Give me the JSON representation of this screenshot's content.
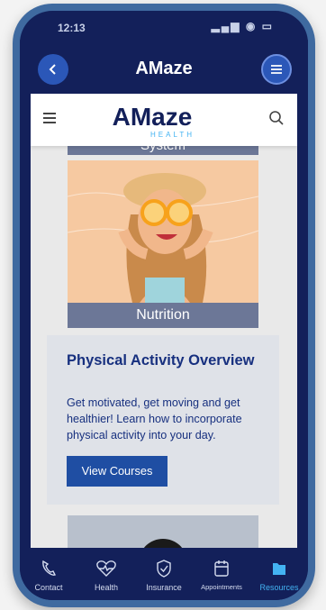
{
  "status": {
    "time": "12:13",
    "icons": "▂▄▆ ◉ ▭"
  },
  "app": {
    "logo_text": "AMaze"
  },
  "site": {
    "logo_main": "AMaze",
    "logo_sub": "HEALTH"
  },
  "previous_card": {
    "label": "System"
  },
  "nutrition_card": {
    "caption": "Nutrition"
  },
  "activity_card": {
    "title": "Physical Activity Overview",
    "description": "Get motivated, get moving and get healthier! Learn how to incorporate physical activity into your day.",
    "button_label": "View Courses"
  },
  "bottom_nav": {
    "items": [
      {
        "label": "Contact",
        "icon": "phone-icon"
      },
      {
        "label": "Health",
        "icon": "heart-icon"
      },
      {
        "label": "Insurance",
        "icon": "shield-icon"
      },
      {
        "label": "Appointments",
        "icon": "calendar-icon"
      },
      {
        "label": "Resources",
        "icon": "folder-icon"
      }
    ],
    "active_index": 4
  },
  "colors": {
    "navy": "#13205a",
    "blue": "#1f4ea3",
    "accent": "#43b3f2",
    "card_bg": "#dfe2e8"
  }
}
